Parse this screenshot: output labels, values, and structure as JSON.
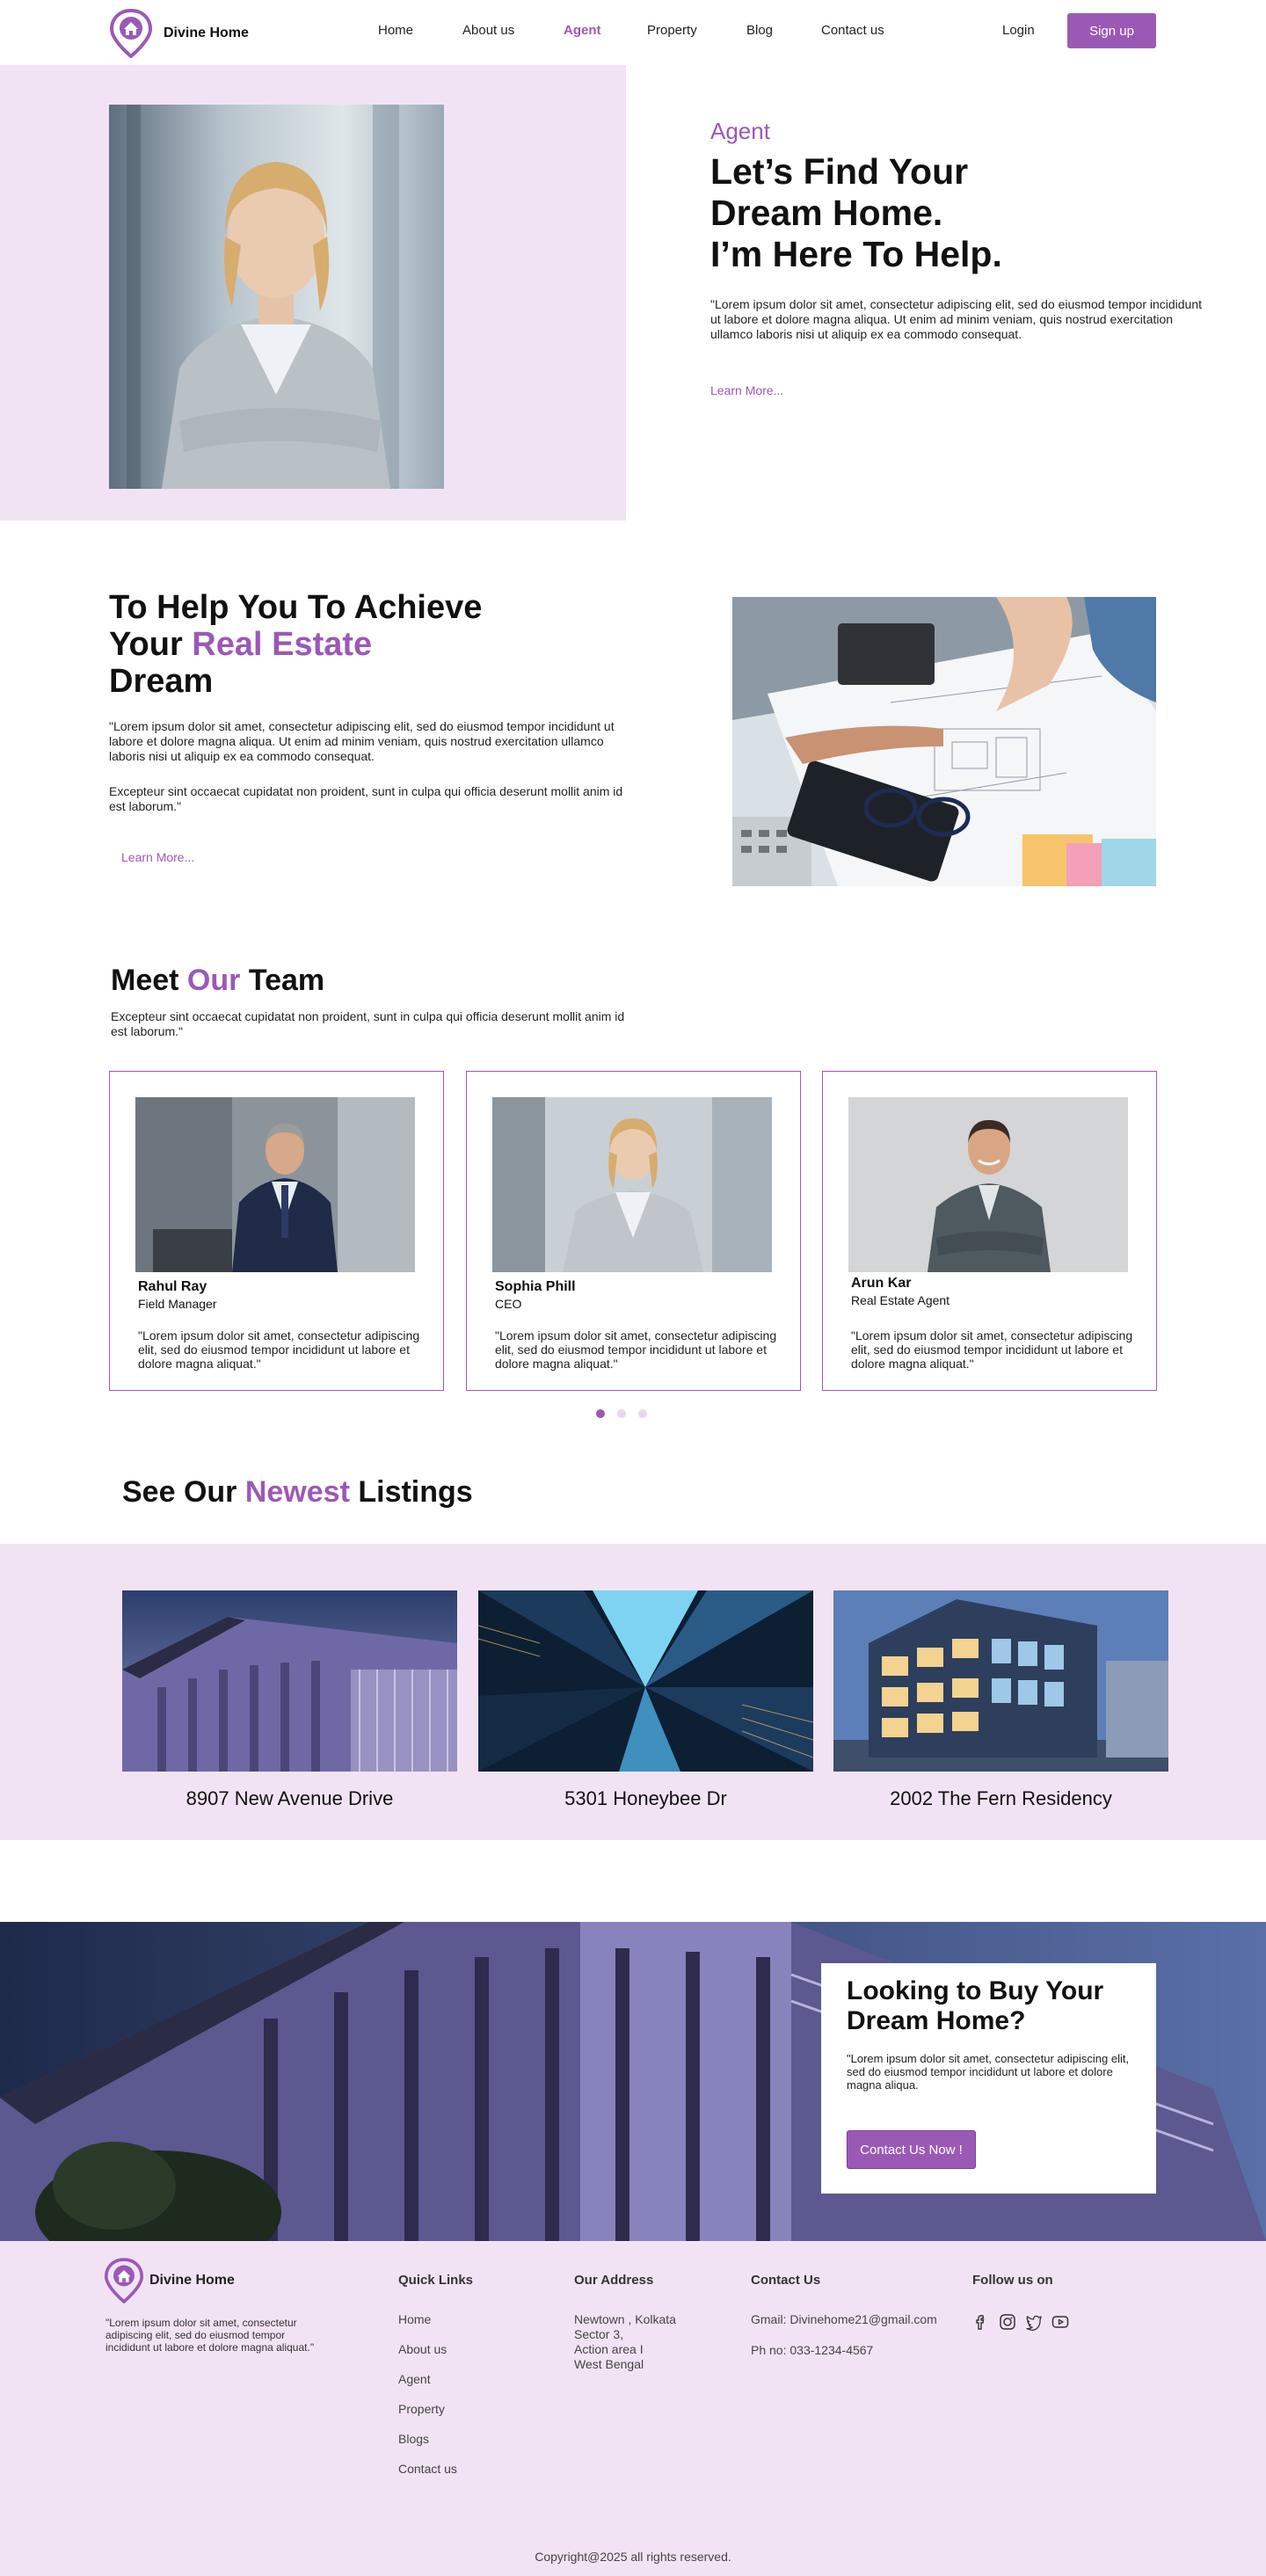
{
  "brand": {
    "name": "Divine Home",
    "accent": "#9b59b6",
    "tint": "#f2e3f4"
  },
  "nav": {
    "links": [
      "Home",
      "About us",
      "Agent",
      "Property",
      "Blog",
      "Contact us"
    ],
    "active": "Agent",
    "login": "Login",
    "signup": "Sign up"
  },
  "hero": {
    "eyebrow": "Agent",
    "title_lines": [
      "Let’s Find Your",
      "Dream Home.",
      "I’m Here To Help."
    ],
    "text": "\"Lorem ipsum dolor sit amet, consectetur adipiscing elit, sed do eiusmod tempor incididunt ut labore et dolore magna aliqua. Ut enim ad minim veniam, quis nostrud exercitation ullamco laboris nisi ut aliquip ex ea commodo consequat.",
    "link": "Learn More..."
  },
  "achieve": {
    "title_a": "To Help You To Achieve",
    "title_b": "Your ",
    "title_hl": "Real Estate",
    "title_c": "Dream",
    "p1": "\"Lorem ipsum dolor sit amet, consectetur adipiscing elit, sed do eiusmod tempor incididunt ut labore et dolore magna aliqua. Ut enim ad minim veniam, quis nostrud exercitation ullamco laboris nisi ut aliquip ex ea commodo consequat.",
    "p2": "Excepteur sint occaecat cupidatat non proident, sunt in culpa qui officia deserunt mollit anim id est laborum.\"",
    "link": "Learn More..."
  },
  "team": {
    "title_a": "Meet ",
    "title_hl": "Our",
    "title_b": " Team",
    "subtitle": "Excepteur sint occaecat cupidatat non proident, sunt in culpa qui officia deserunt mollit anim id est laborum.\"",
    "members": [
      {
        "name": "Rahul Ray",
        "role": "Field Manager",
        "text": "\"Lorem ipsum dolor sit amet, consectetur adipiscing elit, sed do eiusmod tempor incididunt ut labore et dolore magna aliquat.\""
      },
      {
        "name": "Sophia Phill",
        "role": "CEO",
        "text": "\"Lorem ipsum dolor sit amet, consectetur adipiscing elit, sed do eiusmod tempor incididunt ut labore et dolore magna aliquat.\""
      },
      {
        "name": "Arun Kar",
        "role": "Real Estate Agent",
        "text": "\"Lorem ipsum dolor sit amet, consectetur adipiscing elit, sed do eiusmod tempor incididunt ut labore et dolore magna aliquat.\""
      }
    ],
    "carousel_active": 1,
    "carousel_count": 3
  },
  "listings": {
    "title_a": "See Our ",
    "title_hl": "Newest",
    "title_b": " Listings",
    "items": [
      "8907 New Avenue Drive",
      "5301 Honeybee Dr",
      "2002 The Fern Residency"
    ]
  },
  "cta": {
    "title": "Looking to Buy Your Dream Home?",
    "text": "\"Lorem ipsum dolor sit amet, consectetur adipiscing elit, sed do eiusmod tempor incididunt ut labore et dolore magna aliqua.",
    "button": "Contact Us Now !"
  },
  "footer": {
    "brand": "Divine Home",
    "about": "\"Lorem ipsum dolor sit amet, consectetur adipiscing elit, sed do eiusmod tempor incididunt ut labore et dolore magna aliquat.\"",
    "quick_links_head": "Quick Links",
    "quick_links": [
      "Home",
      "About us",
      "Agent",
      "Property",
      "Blogs",
      "Contact us"
    ],
    "address_head": "Our Address",
    "address_lines": [
      "Newtown , Kolkata",
      "Sector 3,",
      "Action area I",
      "West Bengal"
    ],
    "contact_head": "Contact Us",
    "email": "Gmail: Divinehome21@gmail.com",
    "phone": "Ph no: 033-1234-4567",
    "follow_head": "Follow us on",
    "socials": [
      "facebook-icon",
      "instagram-icon",
      "twitter-icon",
      "youtube-icon"
    ],
    "copyright": "Copyright@2025 all rights reserved."
  }
}
